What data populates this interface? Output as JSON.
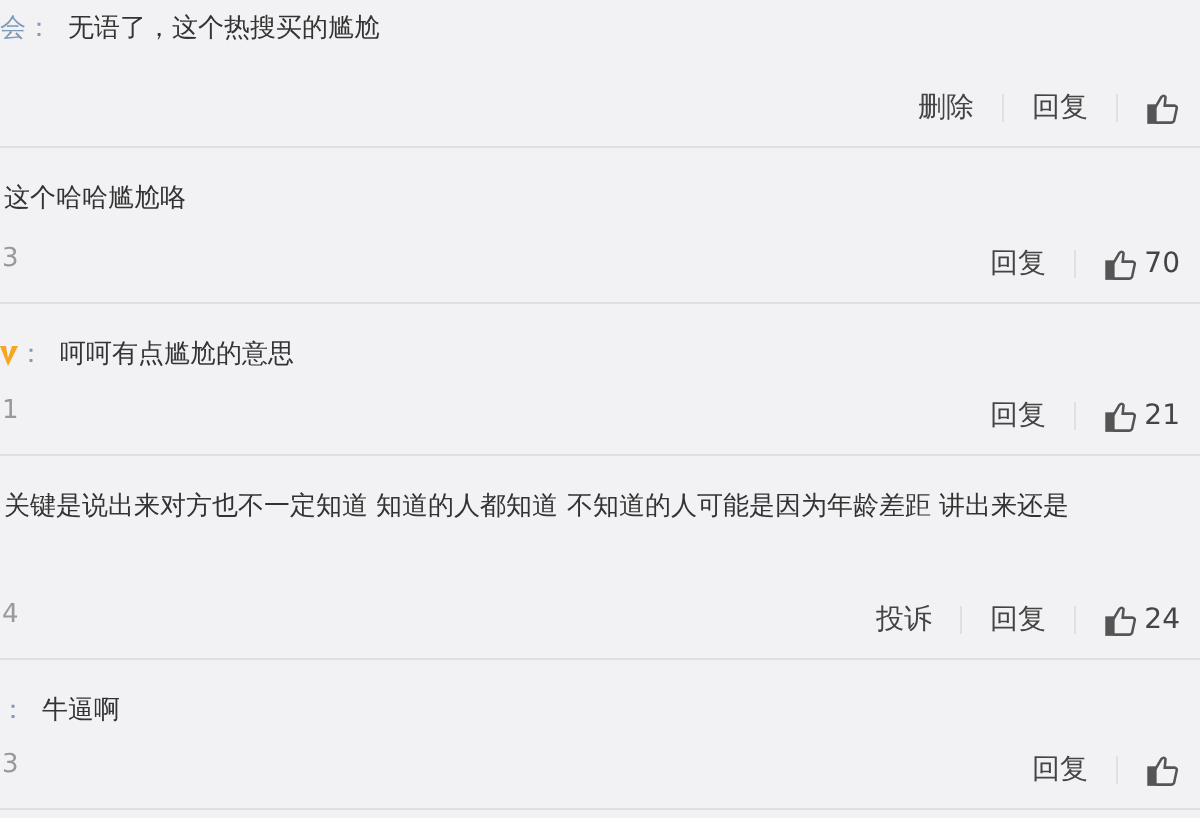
{
  "comments": [
    {
      "name": "会：",
      "verified": false,
      "text": "无语了，这个热搜买的尴尬",
      "actions": [
        "删除",
        "回复"
      ]
    },
    {
      "verified": false,
      "text": "这个哈哈尴尬咯",
      "date": "3",
      "actions": [
        "回复"
      ],
      "likes": "70"
    },
    {
      "name": "：",
      "verified": true,
      "text": "呵呵有点尴尬的意思",
      "date": "1",
      "actions": [
        "回复"
      ],
      "likes": "21"
    },
    {
      "verified": false,
      "text": "关键是说出来对方也不一定知道 知道的人都知道 不知道的人可能是因为年龄差距 讲出来还是",
      "date": "4",
      "actions": [
        "投诉",
        "回复"
      ],
      "likes": "24"
    },
    {
      "name": "：",
      "verified": false,
      "text": "牛逼啊",
      "date": "3",
      "actions": [
        "回复"
      ]
    }
  ]
}
